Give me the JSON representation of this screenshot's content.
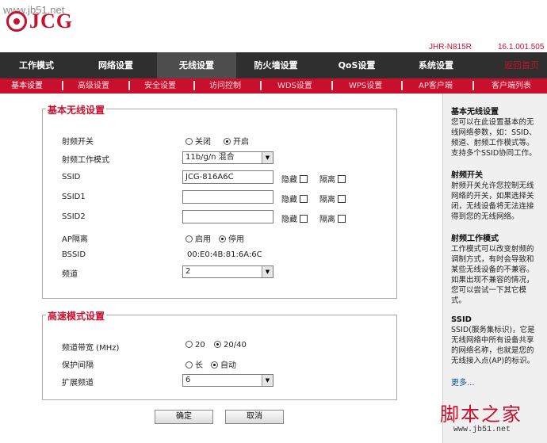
{
  "watermark": "www.jb51.net",
  "brand": "JCG",
  "model": "JHR-N815R",
  "firmware": "16.1.001.505",
  "main_nav": [
    "工作模式",
    "网络设置",
    "无线设置",
    "防火墙设置",
    "QoS设置",
    "系统设置",
    "返回首页"
  ],
  "sub_nav": [
    "基本设置",
    "高级设置",
    "安全设置",
    "访问控制",
    "WDS设置",
    "WPS设置",
    "AP客户端",
    "客户端列表"
  ],
  "basic": {
    "title": "基本无线设置",
    "radio_switch": {
      "label": "射频开关",
      "off": "关闭",
      "on": "开启",
      "selected": "on"
    },
    "radio_mode": {
      "label": "射频工作模式",
      "value": "11b/g/n 混合"
    },
    "ssid": {
      "label": "SSID",
      "value": "JCG-816A6C",
      "hide": "隐藏",
      "isolate": "隔离"
    },
    "ssid1": {
      "label": "SSID1",
      "value": "",
      "hide": "隐藏",
      "isolate": "隔离"
    },
    "ssid2": {
      "label": "SSID2",
      "value": "",
      "hide": "隐藏",
      "isolate": "隔离"
    },
    "ap_isolation": {
      "label": "AP隔离",
      "enable": "启用",
      "disable": "停用",
      "selected": "disable"
    },
    "bssid": {
      "label": "BSSID",
      "value": "00:E0:4B:81:6A:6C"
    },
    "channel": {
      "label": "频道",
      "value": "2"
    }
  },
  "advanced": {
    "title": "高速模式设置",
    "bandwidth": {
      "label": "频道带宽 (MHz)",
      "opt20": "20",
      "opt2040": "20/40",
      "selected": "20/40"
    },
    "guard": {
      "label": "保护间隔",
      "long": "长",
      "auto": "自动",
      "selected": "auto"
    },
    "ext_channel": {
      "label": "扩展频道",
      "value": "6"
    }
  },
  "buttons": {
    "ok": "确定",
    "cancel": "取消"
  },
  "help": [
    {
      "title": "基本无线设置",
      "text": "您可以在此设置基本的无线网络参数，如：SSID、频道、射频工作模式等。支持多个SSID协同工作。"
    },
    {
      "title": "射频开关",
      "text": "射频开关允许您控制无线网络的开关，如果选择关闭，无线设备将无法连接得到您的无线网络。"
    },
    {
      "title": "射频工作模式",
      "text": "工作模式可以改变射频的调制方式，有时会导致和某些无线设备的不兼容。如果出现不兼容的情况，您可以尝试一下其它模式。"
    },
    {
      "title": "SSID",
      "text": "SSID(服务集标识)，它是无线网络中所有设备共享的网络名称，也就是您的无线接入点(AP)的标识。"
    }
  ],
  "help_more": "更多...",
  "corner_logo": "脚本之家",
  "corner_url": "www.jb51.net"
}
